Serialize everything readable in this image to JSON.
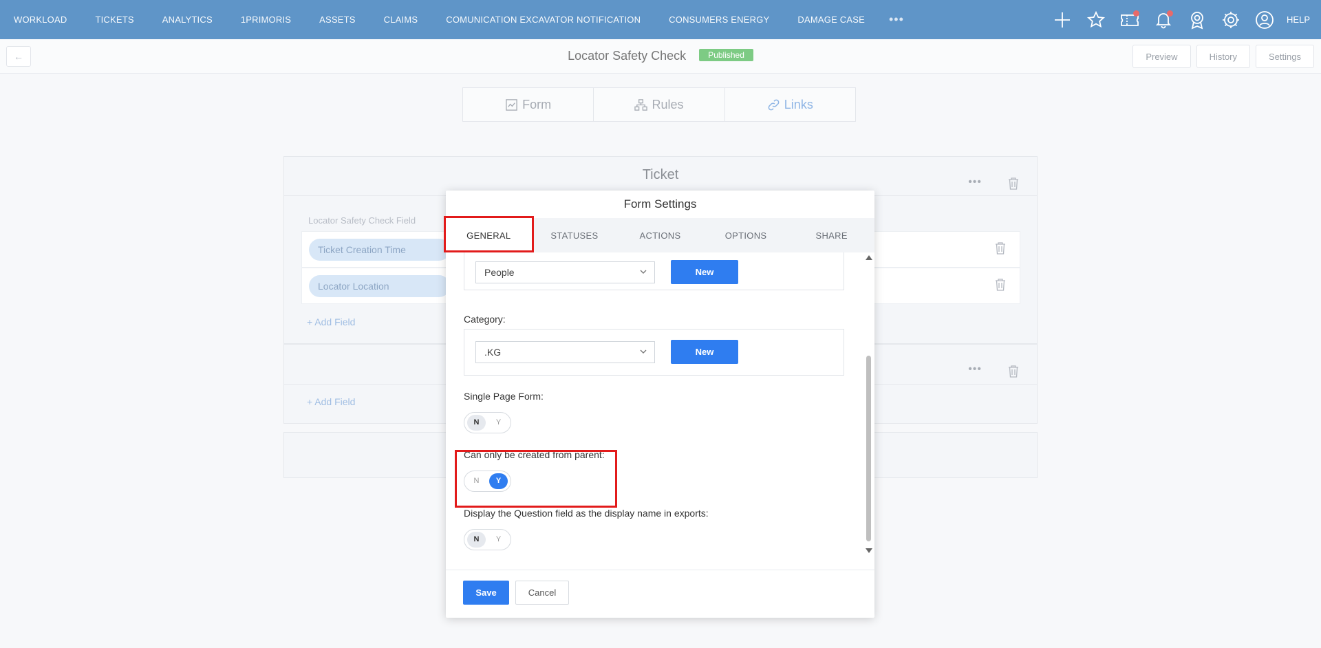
{
  "topnav": {
    "items": [
      "WORKLOAD",
      "TICKETS",
      "ANALYTICS",
      "1PRIMORIS",
      "ASSETS",
      "CLAIMS",
      "COMUNICATION EXCAVATOR NOTIFICATION",
      "CONSUMERS ENERGY",
      "DAMAGE CASE"
    ],
    "more": "•••",
    "help": "HELP",
    "icons": [
      "plus-icon",
      "star-icon",
      "ticket-icon",
      "bell-icon",
      "award-icon",
      "gear-icon",
      "user-icon"
    ]
  },
  "subbar": {
    "back": "←",
    "title": "Locator Safety Check",
    "status": "Published",
    "preview": "Preview",
    "history": "History",
    "settings": "Settings"
  },
  "builder_tabs": {
    "form": "Form",
    "rules": "Rules",
    "links": "Links"
  },
  "panel1": {
    "title": "Ticket",
    "field_label": "Locator Safety Check Field",
    "rows": [
      "Ticket Creation Time",
      "Locator Location"
    ],
    "add_field": "+ Add Field"
  },
  "panel2": {
    "add_field": "+ Add Field"
  },
  "modal": {
    "title": "Form Settings",
    "tabs": [
      "GENERAL",
      "STATUSES",
      "ACTIONS",
      "OPTIONS",
      "SHARE"
    ],
    "people_select": "People",
    "new_label": "New",
    "category_label": "Category:",
    "category_select": ".KG",
    "single_page_label": "Single Page Form:",
    "parent_label": "Can only be created from parent:",
    "display_question_label": "Display the Question field as the display name in exports:",
    "toggle_n": "N",
    "toggle_y": "Y",
    "save": "Save",
    "cancel": "Cancel"
  },
  "colors": {
    "nav": "#5f95c8",
    "primary": "#2f7df0",
    "published": "#7dcb84",
    "highlight": "#e21b1b"
  }
}
